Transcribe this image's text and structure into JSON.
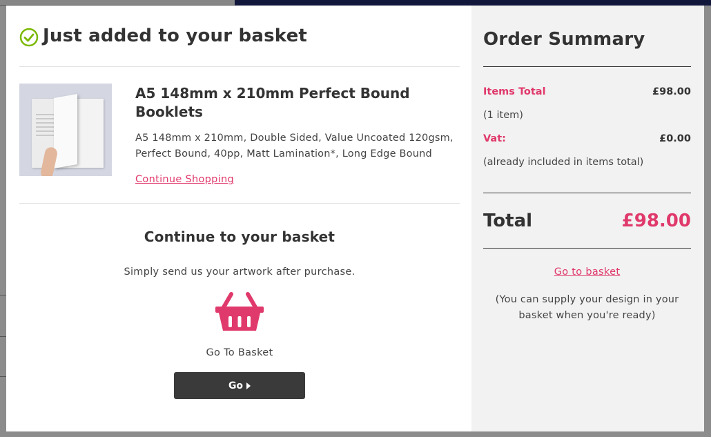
{
  "modal": {
    "added_title": "Just added to your basket",
    "product": {
      "title": "A5 148mm x 210mm Perfect Bound Booklets",
      "description": "A5 148mm x 210mm, Double Sided, Value Uncoated 120gsm, Perfect Bound, 40pp, Matt Lamination*, Long Edge Bound",
      "continue_link": "Continue Shopping"
    },
    "basket": {
      "heading": "Continue to your basket",
      "subtext": "Simply send us your artwork after purchase.",
      "go_to_basket_text": "Go To Basket",
      "go_button_label": "Go"
    }
  },
  "summary": {
    "title": "Order Summary",
    "items_total_label": "Items Total",
    "items_total_value": "£98.00",
    "item_count": "(1 item)",
    "vat_label": "Vat:",
    "vat_value": "£0.00",
    "vat_note": "(already included in items total)",
    "total_label": "Total",
    "total_value": "£98.00",
    "go_to_basket_link": "Go to basket",
    "supply_note": "(You can supply your design in your basket when you're ready)"
  },
  "colors": {
    "accent": "#e0396b",
    "check": "#7ab800",
    "button": "#3a3a3a",
    "summary_bg": "#f2f2f2"
  },
  "icons": [
    "check-circle-icon",
    "basket-icon",
    "caret-right-icon"
  ]
}
